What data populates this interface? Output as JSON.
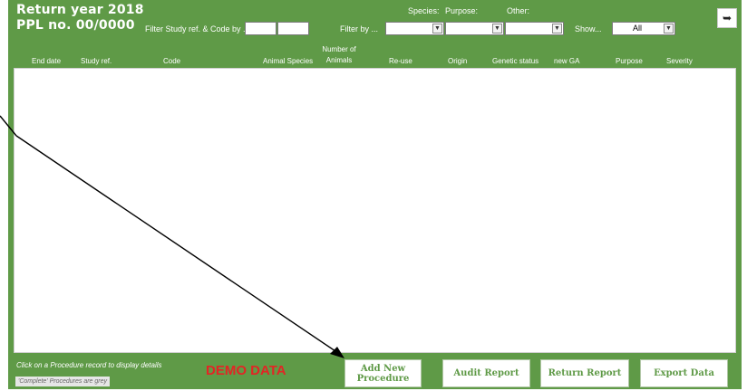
{
  "header": {
    "return_year": "Return year 2018",
    "ppl_no": "PPL no. 00/0000",
    "filter_study_label": "Filter Study ref. & Code by ...",
    "filter_by_label": "Filter by ...",
    "species_label": "Species:",
    "purpose_label": "Purpose:",
    "other_label": "Other:",
    "show_label": "Show...",
    "show_value": "All"
  },
  "columns": {
    "end_date": "End date",
    "study_ref": "Study ref.",
    "code": "Code",
    "animal_species": "Animal Species",
    "number_of": "Number of",
    "animals": "Animals",
    "re_use": "Re-use",
    "origin": "Origin",
    "genetic_status": "Genetic status",
    "new_ga": "new GA",
    "purpose": "Purpose",
    "severity": "Severity"
  },
  "footer": {
    "hint_click": "Click on a Procedure record to display details",
    "hint_grey": "'Complete' Procedures are grey",
    "demo": "DEMO DATA",
    "add_line1": "Add New",
    "add_line2": "Procedure",
    "audit": "Audit Report",
    "return": "Return Report",
    "export": "Export Data"
  },
  "colors": {
    "panel": "#5f9a47",
    "button_text": "#5f9a47",
    "demo_text": "#e32525"
  },
  "icons": {
    "exit": "exit-door-icon",
    "dropdown": "chevron-down-icon"
  }
}
